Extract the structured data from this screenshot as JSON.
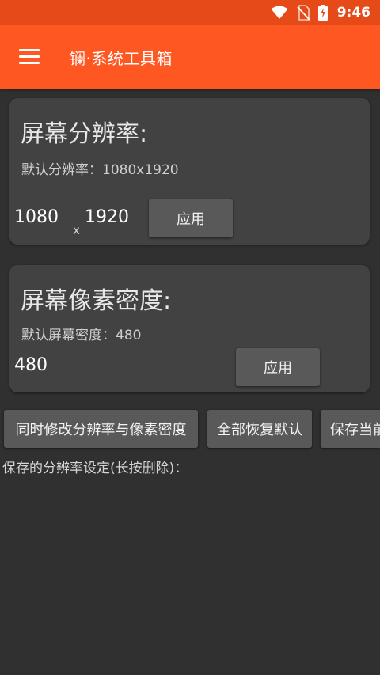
{
  "status_bar": {
    "time": "9:46",
    "icons": [
      "wifi-icon",
      "no-sim-icon",
      "battery-charging-icon"
    ]
  },
  "app_bar": {
    "title": "镧·系统工具箱",
    "menu_icon": "hamburger-menu-icon"
  },
  "resolution_card": {
    "title": "屏幕分辨率:",
    "default_text": "默认分辨率：1080x1920",
    "width_value": "1080",
    "separator": "x",
    "height_value": "1920",
    "apply_label": "应用"
  },
  "density_card": {
    "title": "屏幕像素密度:",
    "default_text": "默认屏幕密度：480",
    "density_value": "480",
    "apply_label": "应用"
  },
  "actions": {
    "modify_both_label": "同时修改分辨率与像素密度",
    "restore_defaults_label": "全部恢复默认",
    "save_current_label": "保存当前"
  },
  "saved_list": {
    "header": "保存的分辨率设定(长按删除)："
  },
  "colors": {
    "status_bar": "#e64a19",
    "app_bar": "#ff5722",
    "background": "#303030",
    "card": "#424242",
    "button": "#595959"
  }
}
